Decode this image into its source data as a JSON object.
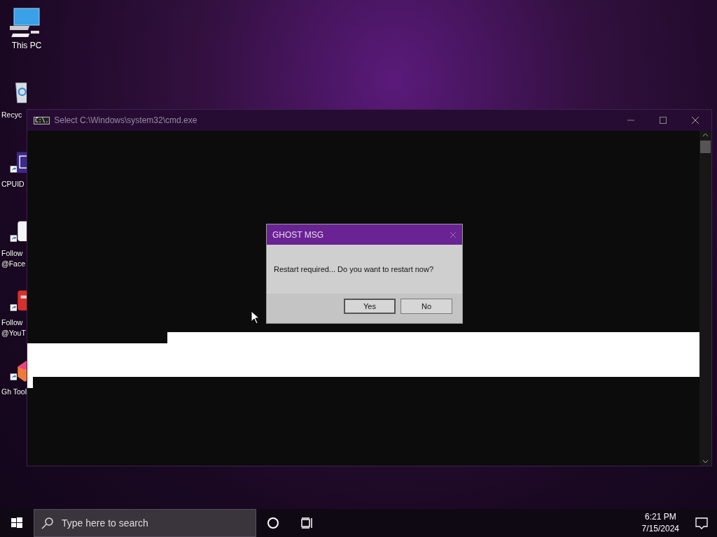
{
  "desktop_icons": [
    {
      "label": "This PC",
      "kind": "computer",
      "shortcut": false
    },
    {
      "label": "Recyc",
      "kind": "recycle",
      "shortcut": false
    },
    {
      "label": "CPUID",
      "kind": "chip",
      "shortcut": true
    },
    {
      "label": "Follow @Face",
      "kind": "facebook",
      "shortcut": true
    },
    {
      "label": "Follow @YouT",
      "kind": "youtube",
      "shortcut": true
    },
    {
      "label": "Gh Tool",
      "kind": "app",
      "shortcut": true
    }
  ],
  "console_window": {
    "title": "Select C:\\Windows\\system32\\cmd.exe",
    "icon_text": "C:\\."
  },
  "dialog": {
    "title": "GHOST MSG",
    "message": "Restart required... Do you want to restart now?",
    "buttons": [
      {
        "label": "Yes",
        "selected": true
      },
      {
        "label": "No",
        "selected": false
      }
    ]
  },
  "taskbar": {
    "search_placeholder": "Type here to search",
    "time": "6:21 PM",
    "date": "7/15/2024"
  }
}
